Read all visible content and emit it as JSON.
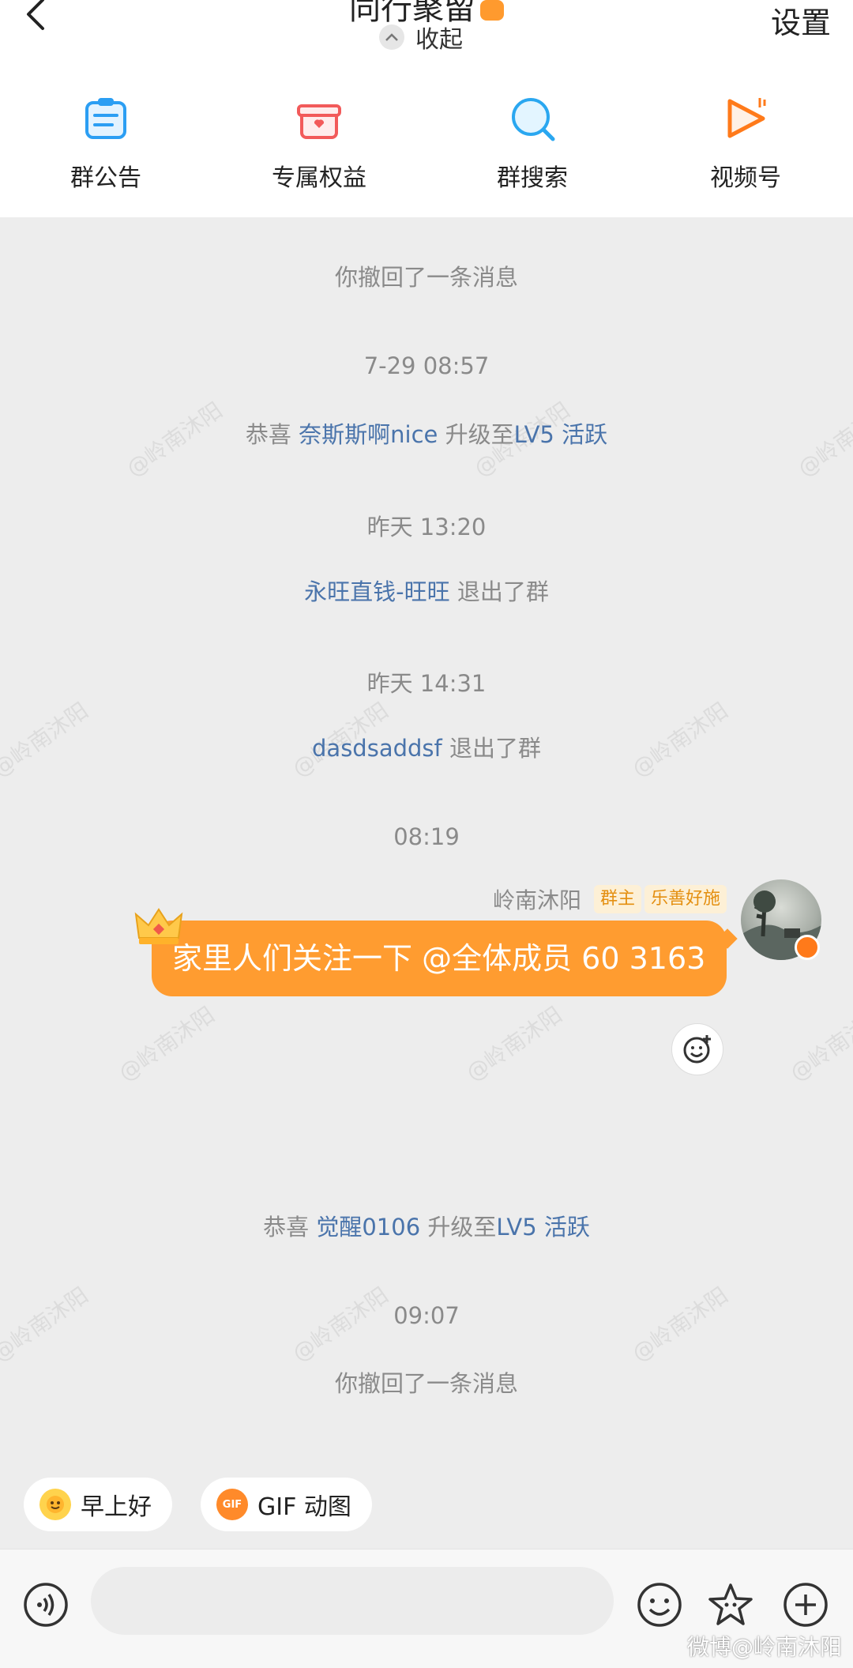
{
  "header": {
    "title": "同行聚留",
    "collapse_label": "收起",
    "settings_label": "设置",
    "shortcuts": [
      {
        "label": "群公告",
        "icon": "announcement-icon"
      },
      {
        "label": "专属权益",
        "icon": "gift-icon"
      },
      {
        "label": "群搜索",
        "icon": "search-icon"
      },
      {
        "label": "视频号",
        "icon": "video-channel-icon"
      }
    ]
  },
  "chat": {
    "recall_1": "你撤回了一条消息",
    "ts_1": "7-29 08:57",
    "levelup_1": {
      "prefix": "恭喜",
      "user": "奈斯斯啊nice",
      "mid": "升级至",
      "level": "LV5 活跃"
    },
    "ts_2": "昨天 13:20",
    "leave_1": {
      "user": "永旺直钱-旺旺",
      "action": "退出了群"
    },
    "ts_3": "昨天 14:31",
    "leave_2": {
      "user": "dasdsaddsf",
      "action": "退出了群"
    },
    "ts_4": "08:19",
    "message": {
      "sender": "岭南沐阳",
      "tag_role": "群主",
      "tag_title": "乐善好施",
      "text": "家里人们关注一下 @全体成员 60 3163"
    },
    "levelup_2": {
      "prefix": "恭喜",
      "user": "觉醒0106",
      "mid": "升级至",
      "level": "LV5 活跃"
    },
    "ts_5": "09:07",
    "recall_2": "你撤回了一条消息",
    "watermark": "@岭南沐阳"
  },
  "quick_chips": [
    {
      "label": "早上好",
      "icon": "sun-emoji-icon"
    },
    {
      "label": "GIF 动图",
      "icon": "gif-icon"
    }
  ],
  "input": {
    "placeholder": ""
  },
  "footer_watermark": "微博@岭南沐阳",
  "colors": {
    "accent": "#ff9c30",
    "link": "#4a74ab",
    "tag_bg": "#fdf0d6",
    "tag_text": "#e48f10"
  }
}
